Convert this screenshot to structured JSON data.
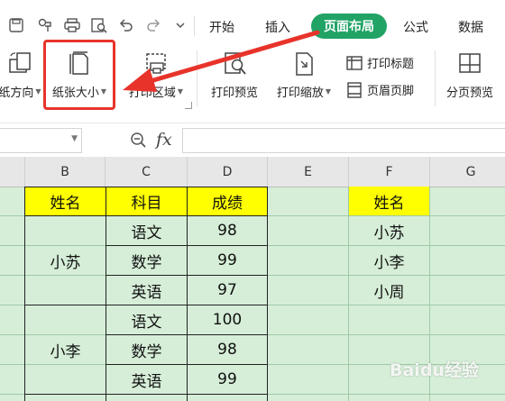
{
  "ribbon_tabs": [
    "开始",
    "插入",
    "页面布局",
    "公式",
    "数据"
  ],
  "active_tab": "页面布局",
  "accent_color": "#21a366",
  "highlight_color": "#e8332b",
  "ribbon": {
    "orientation_label": "纸方向",
    "paper_size_label": "纸张大小",
    "print_area_label": "打印区域",
    "print_preview_label": "打印预览",
    "print_scale_label": "打印缩放",
    "print_titles_label": "打印标题",
    "header_footer_label": "页眉页脚",
    "page_break_preview_label": "分页预览"
  },
  "formula_bar": {
    "name_box_value": "",
    "fx_label": "fx",
    "formula_value": ""
  },
  "columns": [
    "B",
    "C",
    "D",
    "E",
    "F",
    "G"
  ],
  "table": {
    "headers": [
      "姓名",
      "科目",
      "成绩"
    ],
    "groups": [
      {
        "name": "小苏",
        "rows": [
          [
            "语文",
            "98"
          ],
          [
            "数学",
            "99"
          ],
          [
            "英语",
            "97"
          ]
        ]
      },
      {
        "name": "小李",
        "rows": [
          [
            "语文",
            "100"
          ],
          [
            "数学",
            "98"
          ],
          [
            "英语",
            "99"
          ]
        ]
      }
    ]
  },
  "side_list": {
    "header": "姓名",
    "items": [
      "小苏",
      "小李",
      "小周"
    ]
  },
  "watermark": "Baidu经验"
}
